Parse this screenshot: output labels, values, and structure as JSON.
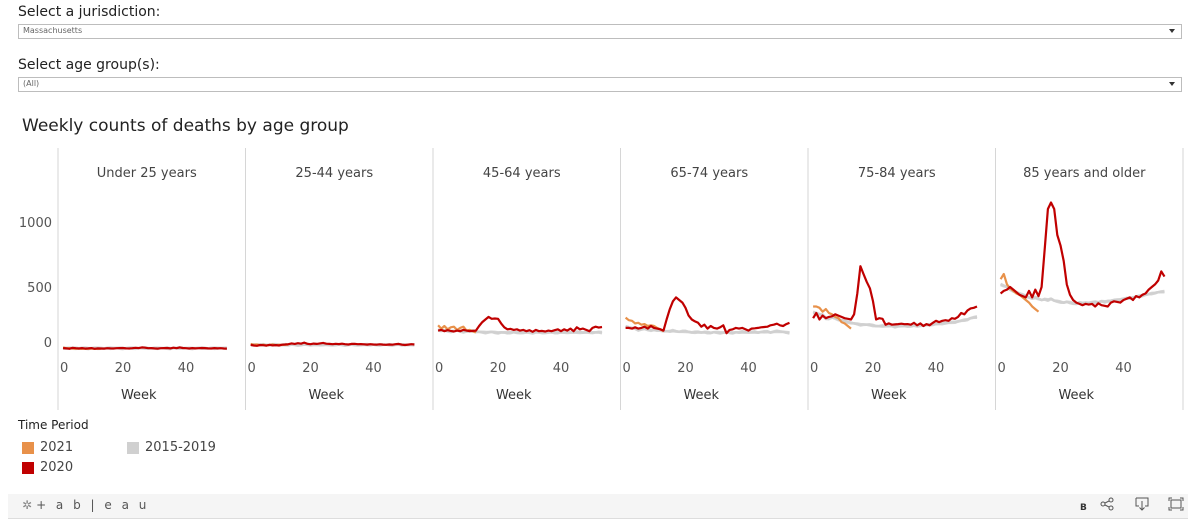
{
  "filters": {
    "jurisdiction_label": "Select a jurisdiction:",
    "jurisdiction_value": "Massachusetts",
    "age_group_label": "Select age group(s):",
    "age_group_value": "(All)"
  },
  "footer": {
    "logo_text": "+ a b | e a u",
    "b_label": "B",
    "icons": [
      "share-icon",
      "download-icon",
      "fullscreen-icon"
    ]
  },
  "legend": {
    "title": "Time Period",
    "items": [
      {
        "label": "2021",
        "color": "#e8914a"
      },
      {
        "label": "2020",
        "color": "#c00000"
      },
      {
        "label": "2015-2019",
        "color": "#d0d0d0"
      }
    ]
  },
  "chart_data": {
    "type": "line",
    "title": "Weekly counts of deaths by age group",
    "xlabel": "Week",
    "ylabel": "",
    "xlim": [
      0,
      55
    ],
    "ylim": [
      -60,
      1400
    ],
    "yticks": [
      0,
      500,
      1000
    ],
    "xticks": [
      0,
      20,
      40
    ],
    "grid": false,
    "legend_position": "bottom-left",
    "colors": {
      "2021": "#e8914a",
      "2020": "#c00000",
      "2015-2019": "#d0d0d0"
    },
    "panels": [
      {
        "label": "Under 25 years",
        "series": [
          {
            "name": "2015-2019",
            "weeks": [
              1,
              53
            ],
            "values": [
              30,
              30,
              32,
              28,
              30,
              29,
              31,
              30,
              28,
              30,
              31,
              29,
              30,
              28,
              29,
              30,
              31,
              30,
              29,
              28,
              30,
              31,
              30,
              29,
              30,
              29,
              31,
              30,
              28,
              29,
              30,
              31,
              29,
              30,
              28,
              30,
              29,
              31,
              30,
              30,
              29,
              28,
              30,
              31,
              29,
              30,
              28,
              30,
              29,
              31,
              30,
              29,
              30
            ]
          },
          {
            "name": "2020",
            "weeks": [
              1,
              53
            ],
            "values": [
              30,
              28,
              25,
              32,
              29,
              27,
              30,
              26,
              28,
              30,
              25,
              28,
              27,
              26,
              29,
              28,
              27,
              29,
              30,
              31,
              28,
              27,
              29,
              32,
              30,
              35,
              33,
              29,
              30,
              28,
              26,
              29,
              30,
              31,
              28,
              33,
              29,
              35,
              31,
              29,
              27,
              30,
              28,
              29,
              31,
              30,
              28,
              27,
              30,
              28,
              29,
              27,
              26
            ]
          },
          {
            "name": "2021",
            "weeks": [
              1,
              13
            ],
            "values": [
              35,
              28,
              30,
              26,
              25,
              27,
              24,
              26,
              25,
              27,
              24,
              26,
              25
            ]
          }
        ]
      },
      {
        "label": "25-44 years",
        "series": [
          {
            "name": "2015-2019",
            "weeks": [
              1,
              53
            ],
            "values": [
              55,
              58,
              56,
              54,
              57,
              55,
              53,
              56,
              58,
              55,
              54,
              56,
              55,
              57,
              56,
              54,
              55,
              57,
              58,
              56,
              55,
              54,
              56,
              57,
              55,
              54,
              56,
              55,
              57,
              56,
              54,
              55,
              57,
              56,
              55,
              54,
              56,
              57,
              55,
              56,
              54,
              55,
              57,
              56,
              55,
              54,
              56,
              57,
              55,
              56,
              54,
              55,
              56
            ]
          },
          {
            "name": "2020",
            "weeks": [
              1,
              53
            ],
            "values": [
              55,
              50,
              48,
              54,
              52,
              49,
              55,
              51,
              53,
              50,
              56,
              58,
              60,
              66,
              62,
              68,
              64,
              72,
              63,
              60,
              65,
              62,
              66,
              70,
              64,
              62,
              60,
              63,
              61,
              64,
              60,
              58,
              62,
              63,
              60,
              61,
              59,
              57,
              60,
              58,
              56,
              59,
              57,
              55,
              58,
              56,
              60,
              62,
              56,
              54,
              57,
              60,
              58
            ]
          },
          {
            "name": "2021",
            "weeks": [
              1,
              13
            ],
            "values": [
              62,
              55,
              58,
              52,
              56,
              50,
              54,
              58,
              52,
              56,
              54,
              58,
              55
            ]
          }
        ]
      },
      {
        "label": "45-64 years",
        "series": [
          {
            "name": "2015-2019",
            "weeks": [
              1,
              53
            ],
            "values": [
              170,
              165,
              168,
              160,
              158,
              162,
              165,
              160,
              155,
              158,
              160,
              162,
              158,
              155,
              152,
              150,
              153,
              155,
              150,
              148,
              152,
              150,
              148,
              150,
              152,
              148,
              150,
              149,
              151,
              150,
              148,
              152,
              150,
              149,
              151,
              150,
              152,
              150,
              149,
              151,
              150,
              152,
              151,
              150,
              153,
              152,
              150,
              151,
              152,
              150,
              151,
              152,
              150
            ]
          },
          {
            "name": "2020",
            "weeks": [
              1,
              53
            ],
            "values": [
              165,
              170,
              160,
              168,
              162,
              158,
              165,
              160,
              170,
              165,
              160,
              162,
              165,
              200,
              230,
              250,
              270,
              255,
              258,
              255,
              220,
              190,
              175,
              178,
              170,
              175,
              165,
              170,
              160,
              168,
              155,
              170,
              160,
              162,
              158,
              165,
              160,
              168,
              175,
              160,
              175,
              165,
              180,
              160,
              190,
              175,
              180,
              170,
              160,
              185,
              195,
              188,
              192
            ]
          },
          {
            "name": "2021",
            "weeks": [
              1,
              13
            ],
            "values": [
              205,
              180,
              200,
              175,
              190,
              195,
              170,
              185,
              195,
              165,
              170,
              160,
              150
            ]
          }
        ]
      },
      {
        "label": "65-74 years",
        "series": [
          {
            "name": "2015-2019",
            "weeks": [
              1,
              53
            ],
            "values": [
              195,
              190,
              185,
              180,
              170,
              175,
              178,
              172,
              168,
              170,
              165,
              168,
              162,
              160,
              158,
              165,
              160,
              155,
              158,
              160,
              155,
              150,
              152,
              155,
              150,
              152,
              150,
              148,
              152,
              150,
              148,
              150,
              152,
              150,
              148,
              152,
              150,
              155,
              153,
              150,
              152,
              155,
              150,
              153,
              155,
              158,
              150,
              155,
              160,
              158,
              155,
              150,
              148
            ]
          },
          {
            "name": "2020",
            "weeks": [
              1,
              53
            ],
            "values": [
              185,
              185,
              180,
              190,
              180,
              185,
              195,
              180,
              200,
              185,
              180,
              175,
              165,
              250,
              330,
              390,
              420,
              400,
              380,
              340,
              280,
              250,
              235,
              225,
              195,
              210,
              180,
              200,
              185,
              180,
              190,
              205,
              145,
              170,
              175,
              185,
              180,
              185,
              175,
              165,
              180,
              182,
              185,
              190,
              192,
              195,
              205,
              210,
              218,
              205,
              200,
              215,
              225
            ]
          },
          {
            "name": "2021",
            "weeks": [
              1,
              13
            ],
            "values": [
              265,
              245,
              240,
              220,
              225,
              210,
              215,
              200,
              205,
              200,
              185,
              175,
              160
            ]
          }
        ]
      },
      {
        "label": "75-84 years",
        "series": [
          {
            "name": "2015-2019",
            "weeks": [
              1,
              53
            ],
            "values": [
              305,
              300,
              290,
              285,
              260,
              255,
              265,
              260,
              250,
              245,
              240,
              230,
              225,
              220,
              215,
              210,
              212,
              210,
              208,
              205,
              200,
              198,
              200,
              202,
              198,
              200,
              195,
              200,
              198,
              202,
              200,
              198,
              202,
              200,
              205,
              203,
              208,
              210,
              212,
              215,
              218,
              220,
              222,
              225,
              228,
              230,
              235,
              240,
              245,
              250,
              260,
              265,
              270
            ]
          },
          {
            "name": "2020",
            "weeks": [
              1,
              53
            ],
            "values": [
              260,
              300,
              250,
              280,
              260,
              270,
              275,
              290,
              280,
              270,
              260,
              255,
              250,
              290,
              450,
              660,
              600,
              540,
              490,
              390,
              250,
              260,
              255,
              210,
              220,
              210,
              212,
              215,
              218,
              214,
              215,
              210,
              225,
              205,
              220,
              200,
              215,
              205,
              225,
              240,
              230,
              240,
              245,
              240,
              260,
              255,
              270,
              300,
              290,
              320,
              335,
              340,
              350
            ]
          },
          {
            "name": "2021",
            "weeks": [
              1,
              13
            ],
            "values": [
              350,
              350,
              340,
              310,
              330,
              300,
              290,
              270,
              260,
              230,
              220,
              200,
              180
            ]
          }
        ]
      },
      {
        "label": "85 years and older",
        "series": [
          {
            "name": "2015-2019",
            "weeks": [
              1,
              53
            ],
            "values": [
              520,
              510,
              500,
              480,
              470,
              460,
              450,
              440,
              430,
              420,
              410,
              420,
              410,
              400,
              405,
              400,
              410,
              395,
              390,
              385,
              380,
              385,
              380,
              375,
              370,
              380,
              375,
              380,
              378,
              380,
              385,
              382,
              390,
              385,
              392,
              395,
              398,
              400,
              405,
              410,
              412,
              415,
              420,
              425,
              430,
              435,
              440,
              445,
              450,
              455,
              460,
              462,
              465
            ]
          },
          {
            "name": "2020",
            "weeks": [
              1,
              53
            ],
            "values": [
              450,
              470,
              480,
              500,
              480,
              460,
              440,
              430,
              420,
              470,
              420,
              480,
              430,
              500,
              800,
              1100,
              1150,
              1100,
              900,
              820,
              700,
              520,
              440,
              400,
              380,
              370,
              360,
              370,
              365,
              370,
              350,
              375,
              360,
              355,
              350,
              380,
              390,
              385,
              380,
              400,
              410,
              420,
              400,
              430,
              420,
              440,
              450,
              480,
              500,
              520,
              550,
              620,
              580
            ]
          },
          {
            "name": "2021",
            "weeks": [
              1,
              13
            ],
            "values": [
              560,
              600,
              520,
              490,
              470,
              450,
              440,
              420,
              400,
              380,
              350,
              330,
              310
            ]
          }
        ]
      }
    ]
  }
}
